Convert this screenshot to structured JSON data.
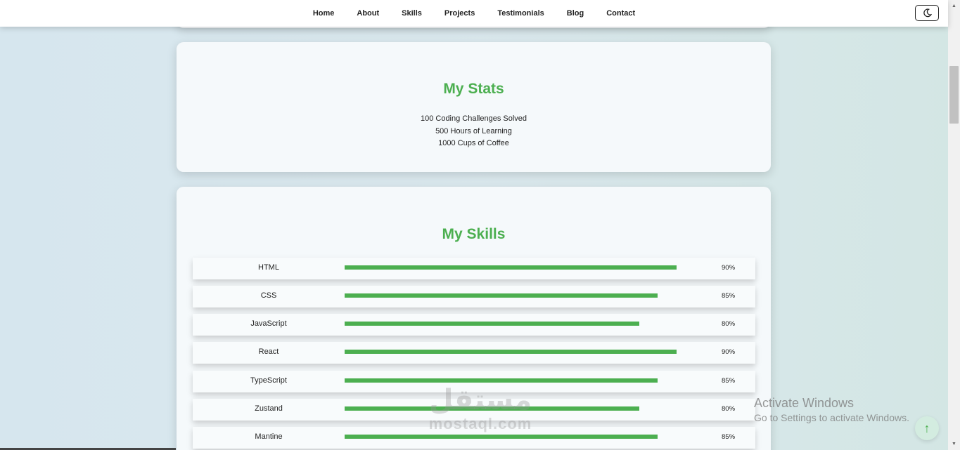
{
  "nav": {
    "links": [
      "Home",
      "About",
      "Skills",
      "Projects",
      "Testimonials",
      "Blog",
      "Contact"
    ],
    "theme_toggle_icon": "moon-icon"
  },
  "stats": {
    "title": "My Stats",
    "items": [
      "100 Coding Challenges Solved",
      "500 Hours of Learning",
      "1000 Cups of Coffee"
    ]
  },
  "skills": {
    "title": "My Skills",
    "items": [
      {
        "name": "HTML",
        "percent": 90,
        "label": "90%"
      },
      {
        "name": "CSS",
        "percent": 85,
        "label": "85%"
      },
      {
        "name": "JavaScript",
        "percent": 80,
        "label": "80%"
      },
      {
        "name": "React",
        "percent": 90,
        "label": "90%"
      },
      {
        "name": "TypeScript",
        "percent": 85,
        "label": "85%"
      },
      {
        "name": "Zustand",
        "percent": 80,
        "label": "80%"
      },
      {
        "name": "Mantine",
        "percent": 85,
        "label": "85%"
      }
    ]
  },
  "colors": {
    "accent": "#4caf50",
    "card_bg": "#f5f9fb"
  },
  "overlay": {
    "activate_title": "Activate Windows",
    "activate_sub": "Go to Settings to activate Windows.",
    "watermark_ar": "مستقل",
    "watermark_en": "mostaql.com",
    "back_to_top": "↑"
  }
}
